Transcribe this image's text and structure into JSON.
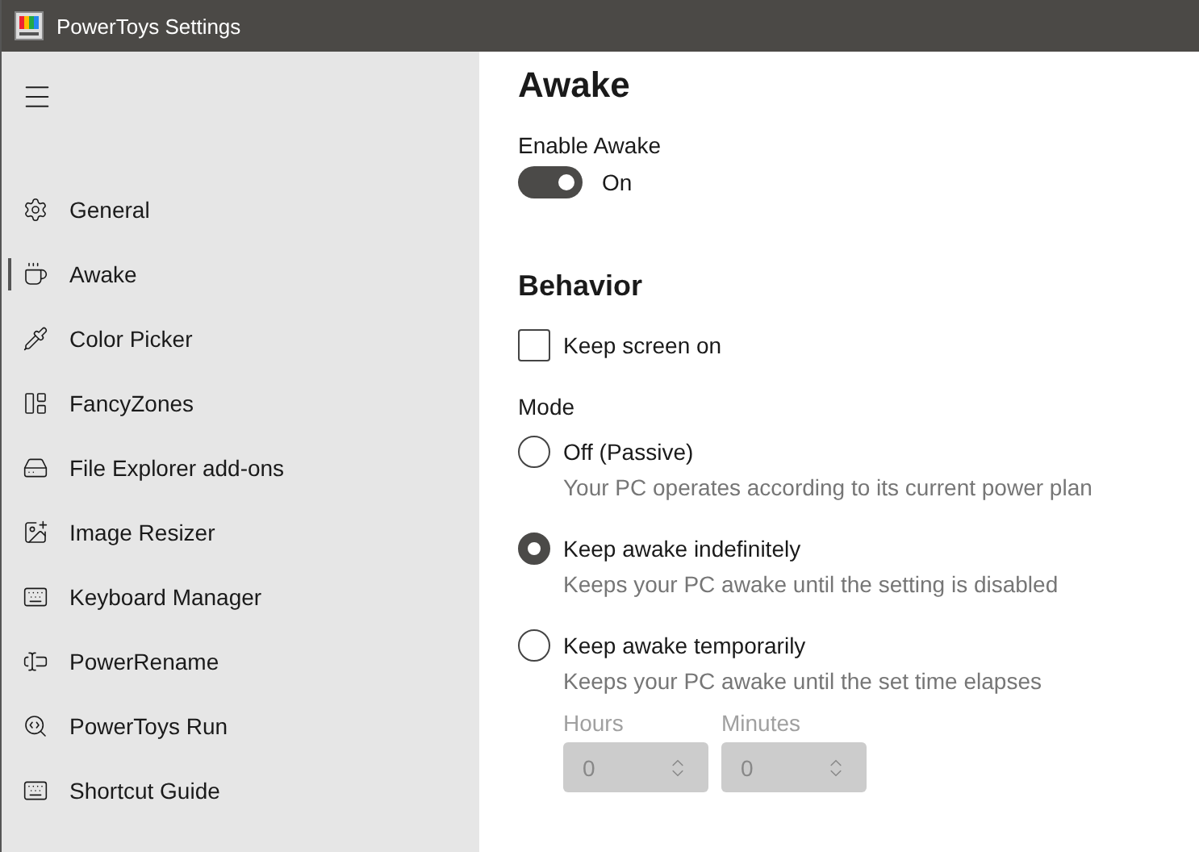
{
  "window": {
    "title": "PowerToys Settings"
  },
  "sidebar": {
    "items": [
      {
        "label": "General",
        "selected": false
      },
      {
        "label": "Awake",
        "selected": true
      },
      {
        "label": "Color Picker",
        "selected": false
      },
      {
        "label": "FancyZones",
        "selected": false
      },
      {
        "label": "File Explorer add-ons",
        "selected": false
      },
      {
        "label": "Image Resizer",
        "selected": false
      },
      {
        "label": "Keyboard Manager",
        "selected": false
      },
      {
        "label": "PowerRename",
        "selected": false
      },
      {
        "label": "PowerToys Run",
        "selected": false
      },
      {
        "label": "Shortcut Guide",
        "selected": false
      }
    ]
  },
  "page": {
    "title": "Awake",
    "enable": {
      "label": "Enable Awake",
      "on": true,
      "state_text": "On"
    },
    "behavior": {
      "heading": "Behavior",
      "keep_screen_on": {
        "label": "Keep screen on",
        "checked": false
      },
      "mode": {
        "label": "Mode",
        "options": [
          {
            "label": "Off (Passive)",
            "description": "Your PC operates according to its current power plan",
            "selected": false
          },
          {
            "label": "Keep awake indefinitely",
            "description": "Keeps your PC awake until the setting is disabled",
            "selected": true
          },
          {
            "label": "Keep awake temporarily",
            "description": "Keeps your PC awake until the set time elapses",
            "selected": false
          }
        ]
      },
      "duration": {
        "disabled": true,
        "fields": [
          {
            "label": "Hours",
            "value": "0"
          },
          {
            "label": "Minutes",
            "value": "0"
          }
        ]
      }
    }
  }
}
